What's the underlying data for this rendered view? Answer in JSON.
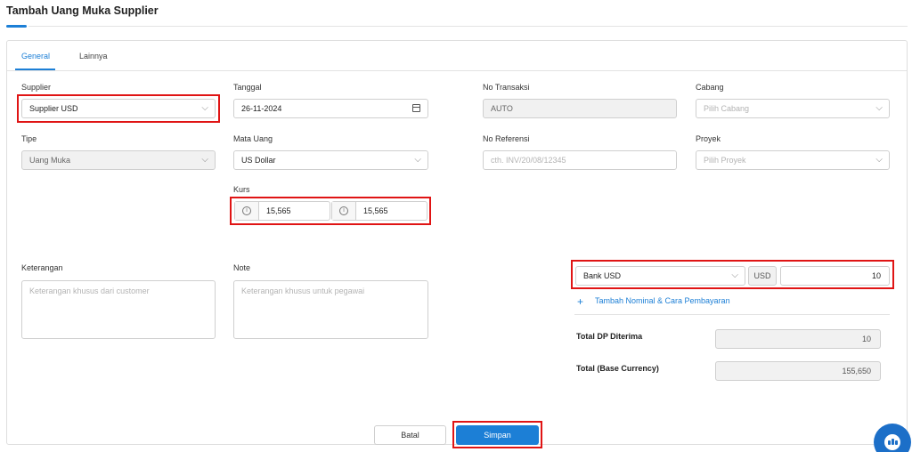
{
  "page": {
    "title": "Tambah Uang Muka Supplier"
  },
  "tabs": [
    {
      "label": "General",
      "active": true
    },
    {
      "label": "Lainnya",
      "active": false
    }
  ],
  "form": {
    "supplier": {
      "label": "Supplier",
      "value": "Supplier USD"
    },
    "tanggal": {
      "label": "Tanggal",
      "value": "26-11-2024"
    },
    "no_transaksi": {
      "label": "No Transaksi",
      "value": "AUTO"
    },
    "cabang": {
      "label": "Cabang",
      "placeholder": "Pilih Cabang"
    },
    "tipe": {
      "label": "Tipe",
      "value": "Uang Muka"
    },
    "mata_uang": {
      "label": "Mata Uang",
      "value": "US Dollar"
    },
    "no_referensi": {
      "label": "No Referensi",
      "placeholder": "cth. INV/20/08/12345"
    },
    "proyek": {
      "label": "Proyek",
      "placeholder": "Pilih Proyek"
    },
    "kurs": {
      "label": "Kurs",
      "value_1": "15,565",
      "value_2": "15,565"
    },
    "keterangan": {
      "label": "Keterangan",
      "placeholder": "Keterangan khusus dari customer"
    },
    "note": {
      "label": "Note",
      "placeholder": "Keterangan khusus untuk pegawai"
    }
  },
  "payment": {
    "account": "Bank USD",
    "currency": "USD",
    "amount": "10",
    "add_link": "Tambah Nominal & Cara Pembayaran"
  },
  "totals": {
    "dp_label": "Total DP Diterima",
    "dp_value": "10",
    "base_label": "Total (Base Currency)",
    "base_value": "155,650"
  },
  "buttons": {
    "cancel": "Batal",
    "save": "Simpan"
  },
  "icons": {
    "chevron": "chevron-down-icon",
    "calendar": "calendar-icon",
    "info": "info-icon",
    "plus": "plus-icon",
    "chat": "chat-icon"
  },
  "colors": {
    "accent": "#1c7fd6",
    "highlight": "#e01414"
  }
}
